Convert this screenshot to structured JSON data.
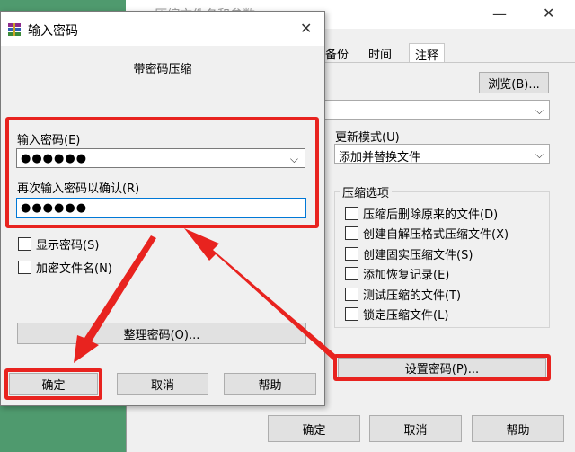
{
  "back": {
    "title": "压缩文件名和参数",
    "tabs": [
      "备份",
      "时间",
      "注释"
    ],
    "browse": "浏览(B)...",
    "update_mode_label": "更新模式(U)",
    "update_mode_value": "添加并替换文件",
    "options_label": "压缩选项",
    "options": [
      "压缩后删除原来的文件(D)",
      "创建自解压格式压缩文件(X)",
      "创建固实压缩文件(S)",
      "添加恢复记录(E)",
      "测试压缩的文件(T)",
      "锁定压缩文件(L)"
    ],
    "set_password": "设置密码(P)...",
    "ok": "确定",
    "cancel": "取消",
    "help": "帮助"
  },
  "dialog": {
    "title": "输入密码",
    "subtitle": "带密码压缩",
    "enter_label": "输入密码(E)",
    "enter_value": "●●●●●●",
    "confirm_label": "再次输入密码以确认(R)",
    "confirm_value": "●●●●●●",
    "show_password": "显示密码(S)",
    "encrypt_names": "加密文件名(N)",
    "organize": "整理密码(O)...",
    "ok": "确定",
    "cancel": "取消",
    "help": "帮助"
  },
  "colors": {
    "highlight": "#e8231f",
    "desktop": "#4f9a6e"
  },
  "icons": {
    "app": "winrar-icon",
    "close": "close-icon",
    "minimize": "minimize-icon",
    "chevron": "chevron-down-icon"
  }
}
